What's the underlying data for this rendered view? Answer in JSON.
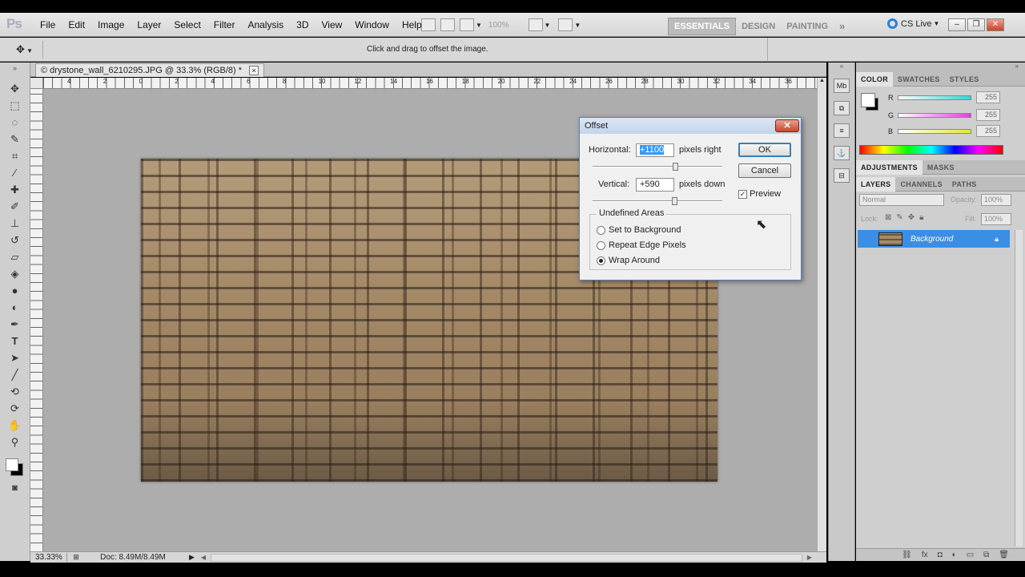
{
  "app": {
    "logo": "Ps"
  },
  "menu": [
    "File",
    "Edit",
    "Image",
    "Layer",
    "Select",
    "Filter",
    "Analysis",
    "3D",
    "View",
    "Window",
    "Help"
  ],
  "toolbar_top": {
    "zoom": "100%"
  },
  "workspaces": {
    "essentials": "ESSENTIALS",
    "design": "DESIGN",
    "painting": "PAINTING",
    "more": "»",
    "cslive": "CS Live"
  },
  "options_bar": {
    "hint": "Click and drag to offset the image."
  },
  "document": {
    "tab_title": "© drystone_wall_6210295.JPG @ 33.3% (RGB/8) *",
    "close": "×"
  },
  "ruler_ticks": [
    "4",
    "2",
    "0",
    "2",
    "4",
    "6",
    "8",
    "10",
    "12",
    "14",
    "16",
    "18",
    "20",
    "22",
    "24",
    "26",
    "28",
    "30",
    "32",
    "34",
    "36"
  ],
  "status": {
    "zoom": "33.33%",
    "doc": "Doc: 8.49M/8.49M"
  },
  "dialog": {
    "title": "Offset",
    "close": "✕",
    "horizontal_label": "Horizontal:",
    "horizontal_value": "+1100",
    "horizontal_unit": "pixels right",
    "vertical_label": "Vertical:",
    "vertical_value": "+590",
    "vertical_unit": "pixels down",
    "ok": "OK",
    "cancel": "Cancel",
    "preview_label": "Preview",
    "preview_checked": true,
    "group_title": "Undefined Areas",
    "options": [
      "Set to Background",
      "Repeat Edge Pixels",
      "Wrap Around"
    ],
    "selected_option": "Wrap Around"
  },
  "color_panel": {
    "tabs": [
      "COLOR",
      "SWATCHES",
      "STYLES"
    ],
    "channels": [
      {
        "name": "R",
        "value": "255",
        "color": "#2fd7d7"
      },
      {
        "name": "G",
        "value": "255",
        "color": "#e040e0"
      },
      {
        "name": "B",
        "value": "255",
        "color": "#e6e633"
      }
    ]
  },
  "adjust_panel": {
    "tabs": [
      "ADJUSTMENTS",
      "MASKS"
    ]
  },
  "layers_panel": {
    "tabs": [
      "LAYERS",
      "CHANNELS",
      "PATHS"
    ],
    "blend_mode": "Normal",
    "opacity_label": "Opacity:",
    "opacity": "100%",
    "lock_label": "Lock:",
    "fill_label": "Fill:",
    "fill": "100%",
    "layers": [
      {
        "name": "Background",
        "selected": true
      }
    ]
  },
  "colors": {
    "accent": "#3b8ee6",
    "canvas": "#adadad"
  }
}
